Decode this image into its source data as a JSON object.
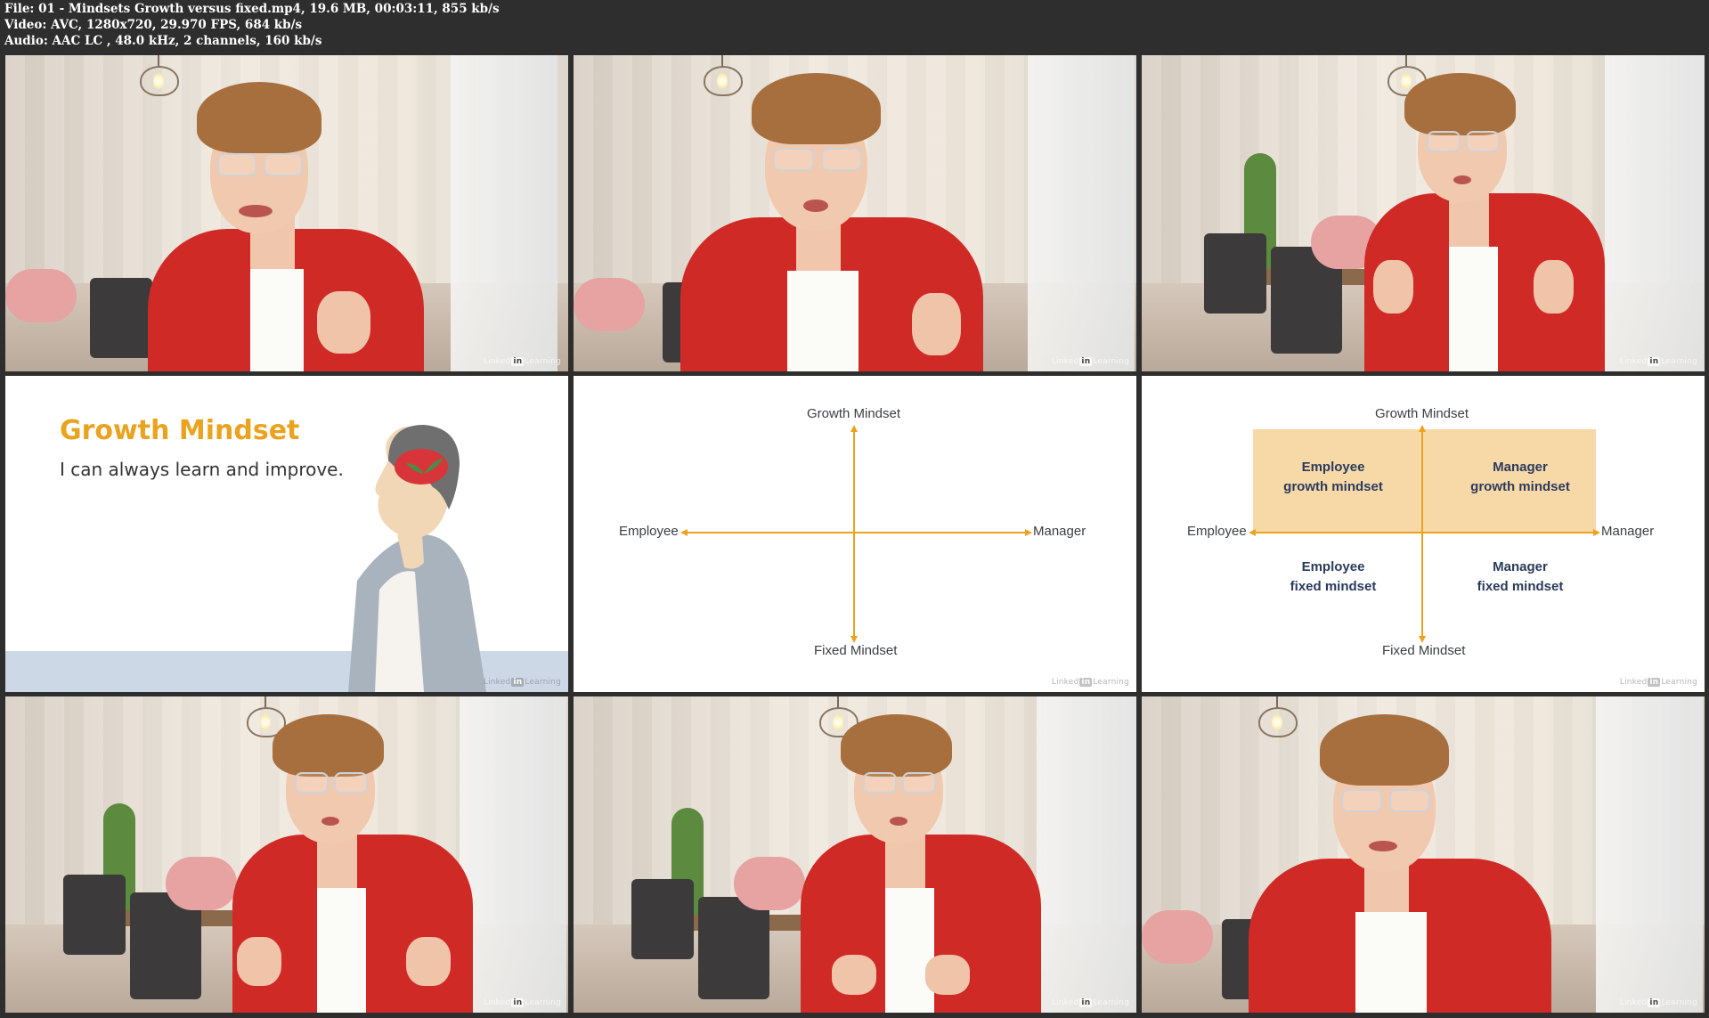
{
  "header": {
    "file_line": "File: 01 - Mindsets Growth versus fixed.mp4, 19.6 MB, 00:03:11, 855 kb/s",
    "video_line": "Video: AVC, 1280x720, 29.970 FPS, 684 kb/s",
    "audio_line": "Audio: AAC LC , 48.0 kHz, 2 channels, 160 kb/s"
  },
  "watermark": {
    "pre": "Linked",
    "in": "in",
    "post": "Learning"
  },
  "slide_growth": {
    "title": "Growth Mindset",
    "subtitle": "I can always learn and improve."
  },
  "diagram_axes": {
    "top": "Growth Mindset",
    "bottom": "Fixed Mindset",
    "left": "Employee",
    "right": "Manager"
  },
  "diagram_quadrants": {
    "top_left_1": "Employee",
    "top_left_2": "growth mindset",
    "top_right_1": "Manager",
    "top_right_2": "growth mindset",
    "bottom_left_1": "Employee",
    "bottom_left_2": "fixed mindset",
    "bottom_right_1": "Manager",
    "bottom_right_2": "fixed mindset"
  },
  "colors": {
    "accent_orange": "#eaa31f",
    "quadrant_fill": "#f7d9a8",
    "jacket_red": "#cf2a25",
    "navy_text": "#2b3a5c"
  }
}
